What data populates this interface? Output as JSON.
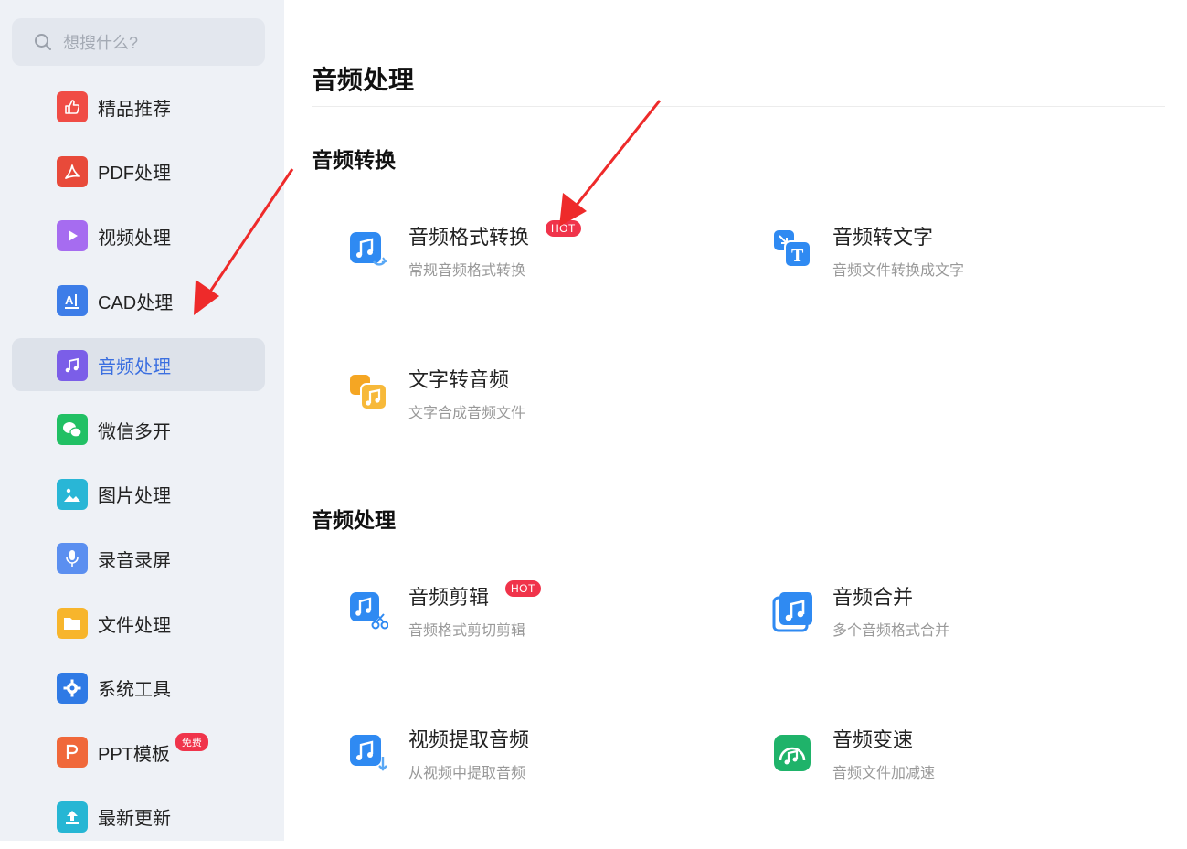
{
  "search": {
    "placeholder": "想搜什么?"
  },
  "sidebar": {
    "items": [
      {
        "label": "精品推荐",
        "icon": "thumbs-up-icon",
        "color": "#f04c45"
      },
      {
        "label": "PDF处理",
        "icon": "pdf-icon",
        "color": "#e84a3a"
      },
      {
        "label": "视频处理",
        "icon": "play-icon",
        "color": "#a66cf0"
      },
      {
        "label": "CAD处理",
        "icon": "cad-icon",
        "color": "#3d7de8"
      },
      {
        "label": "音频处理",
        "icon": "music-icon",
        "color": "#7b5ee8"
      },
      {
        "label": "微信多开",
        "icon": "wechat-icon",
        "color": "#21c064"
      },
      {
        "label": "图片处理",
        "icon": "image-icon",
        "color": "#29b6d6"
      },
      {
        "label": "录音录屏",
        "icon": "microphone-icon",
        "color": "#5b8ff0"
      },
      {
        "label": "文件处理",
        "icon": "folder-icon",
        "color": "#f7b52c"
      },
      {
        "label": "系统工具",
        "icon": "gear-icon",
        "color": "#2f7ae5"
      },
      {
        "label": "PPT模板",
        "icon": "ppt-icon",
        "color": "#f0683a",
        "badge": "免费"
      },
      {
        "label": "最新更新",
        "icon": "upload-icon",
        "color": "#26b6d4"
      }
    ]
  },
  "main": {
    "title": "音频处理",
    "sections": [
      {
        "title": "音频转换",
        "tools": [
          {
            "name": "音频格式转换",
            "desc": "常规音频格式转换",
            "badge": "HOT",
            "icon": "audio-convert-icon"
          },
          {
            "name": "音频转文字",
            "desc": "音频文件转换成文字",
            "icon": "audio-to-text-icon"
          },
          {
            "name": "文字转音频",
            "desc": "文字合成音频文件",
            "icon": "text-to-audio-icon"
          }
        ]
      },
      {
        "title": "音频处理",
        "tools": [
          {
            "name": "音频剪辑",
            "desc": "音频格式剪切剪辑",
            "badge": "HOT",
            "icon": "audio-cut-icon"
          },
          {
            "name": "音频合并",
            "desc": "多个音频格式合并",
            "icon": "audio-merge-icon"
          },
          {
            "name": "视频提取音频",
            "desc": "从视频中提取音频",
            "icon": "video-extract-audio-icon"
          },
          {
            "name": "音频变速",
            "desc": "音频文件加减速",
            "icon": "audio-speed-icon"
          }
        ]
      }
    ]
  },
  "colors": {
    "accent": "#3b6fe0",
    "hot": "#f0334a",
    "arrow": "#ee2a2a"
  }
}
